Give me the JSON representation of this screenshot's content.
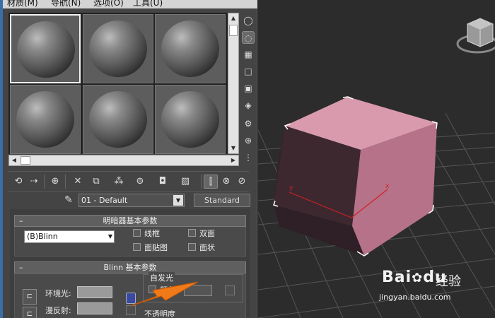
{
  "menu": {
    "items": [
      "材质(M)",
      "导航(N)",
      "选项(O)",
      "工具(U)"
    ]
  },
  "material_slots": [
    {
      "selected": true
    },
    {
      "selected": false
    },
    {
      "selected": false
    },
    {
      "selected": false
    },
    {
      "selected": false
    },
    {
      "selected": false
    }
  ],
  "material": {
    "name": "01 - Default",
    "type_button": "Standard"
  },
  "rollouts": {
    "shader": {
      "title": "明暗器基本参数",
      "shader_value": "(B)Blinn",
      "checkboxes": {
        "wire": "线框",
        "two_sided": "双面",
        "face_map": "面贴图",
        "faceted": "面状"
      }
    },
    "blinn": {
      "title": "Blinn 基本参数",
      "ambient_label": "环境光:",
      "diffuse_label": "漫反射:",
      "self_illum_group": "自发光",
      "self_illum_color": "颜色",
      "opacity_partial": "不透明度"
    }
  },
  "icons": {
    "viewcube": "viewcube-icon",
    "arrow": "orange-arrow-annotation"
  },
  "colors": {
    "panel_bg": "#444444",
    "viewport_bg": "#2c2c2c",
    "cube_top": "#d99aae",
    "cube_right": "#b57289",
    "cube_front": "#3d2830",
    "axis_red": "#d02020",
    "arrow_orange": "#f07a18"
  },
  "watermark": {
    "brand": "Bai",
    "brand_mark": "du",
    "cn": "经验",
    "url": "jingyan.baidu.com"
  }
}
